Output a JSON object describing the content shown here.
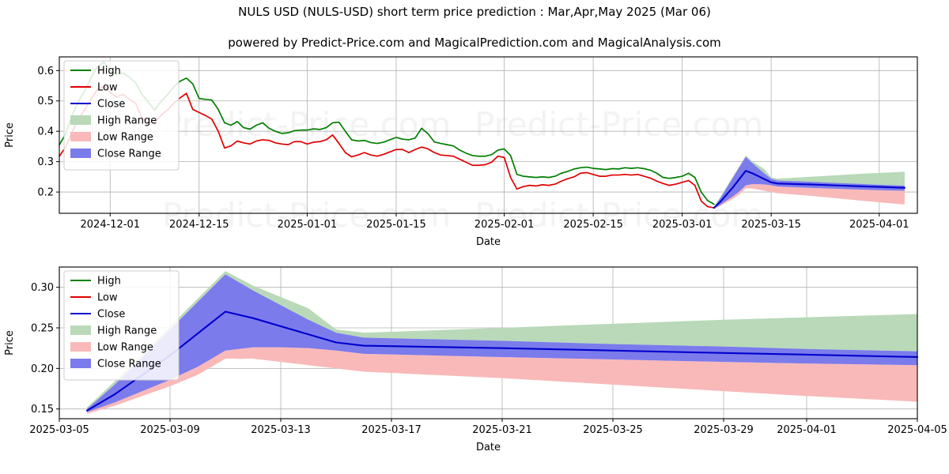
{
  "header": {
    "title": "NULS USD (NULS-USD) short term price prediction : Mar,Apr,May 2025 (Mar 06)",
    "subtitle": "powered by Predict-Price.com and MagicalPrediction.com and MagicalAnalysis.com"
  },
  "watermark": {
    "text": "Predict-Price.com"
  },
  "colors": {
    "high": "#007f00",
    "low": "#e00000",
    "close": "#0000cd",
    "high_range": "#b9d9b9",
    "low_range": "#f9b9b9",
    "close_range": "#7b7bec",
    "grid": "#b0b0b0",
    "frame": "#000000",
    "background": "#ffffff"
  },
  "chart_data": [
    {
      "id": "overview",
      "type": "line",
      "title": "",
      "xlabel": "Date",
      "ylabel": "Price",
      "grid": true,
      "legend_position": "upper left",
      "legend": [
        "High",
        "Low",
        "Close",
        "High Range",
        "Low Range",
        "Close Range"
      ],
      "xlim": [
        "2024-11-23",
        "2025-04-07"
      ],
      "ylim": [
        0.13,
        0.645
      ],
      "yticks": [
        0.2,
        0.3,
        0.4,
        0.5,
        0.6
      ],
      "ytick_labels": [
        "0.2",
        "0.3",
        "0.4",
        "0.5",
        "0.6"
      ],
      "xticks": [
        "2024-12-01",
        "2024-12-15",
        "2025-01-01",
        "2025-01-15",
        "2025-02-01",
        "2025-02-15",
        "2025-03-01",
        "2025-03-15",
        "2025-04-01"
      ],
      "history": {
        "dates": [
          "2024-11-23",
          "2024-11-24",
          "2024-11-25",
          "2024-11-26",
          "2024-11-27",
          "2024-11-28",
          "2024-11-29",
          "2024-11-30",
          "2024-12-01",
          "2024-12-02",
          "2024-12-03",
          "2024-12-04",
          "2024-12-05",
          "2024-12-06",
          "2024-12-07",
          "2024-12-08",
          "2024-12-09",
          "2024-12-10",
          "2024-12-11",
          "2024-12-12",
          "2024-12-13",
          "2024-12-14",
          "2024-12-15",
          "2024-12-16",
          "2024-12-17",
          "2024-12-18",
          "2024-12-19",
          "2024-12-20",
          "2024-12-21",
          "2024-12-22",
          "2024-12-23",
          "2024-12-24",
          "2024-12-25",
          "2024-12-26",
          "2024-12-27",
          "2024-12-28",
          "2024-12-29",
          "2024-12-30",
          "2024-12-31",
          "2025-01-01",
          "2025-01-02",
          "2025-01-03",
          "2025-01-04",
          "2025-01-05",
          "2025-01-06",
          "2025-01-07",
          "2025-01-08",
          "2025-01-09",
          "2025-01-10",
          "2025-01-11",
          "2025-01-12",
          "2025-01-13",
          "2025-01-14",
          "2025-01-15",
          "2025-01-16",
          "2025-01-17",
          "2025-01-18",
          "2025-01-19",
          "2025-01-20",
          "2025-01-21",
          "2025-01-22",
          "2025-01-23",
          "2025-01-24",
          "2025-01-25",
          "2025-01-26",
          "2025-01-27",
          "2025-01-28",
          "2025-01-29",
          "2025-01-30",
          "2025-01-31",
          "2025-02-01",
          "2025-02-02",
          "2025-02-03",
          "2025-02-04",
          "2025-02-05",
          "2025-02-06",
          "2025-02-07",
          "2025-02-08",
          "2025-02-09",
          "2025-02-10",
          "2025-02-11",
          "2025-02-12",
          "2025-02-13",
          "2025-02-14",
          "2025-02-15",
          "2025-02-16",
          "2025-02-17",
          "2025-02-18",
          "2025-02-19",
          "2025-02-20",
          "2025-02-21",
          "2025-02-22",
          "2025-02-23",
          "2025-02-24",
          "2025-02-25",
          "2025-02-26",
          "2025-02-27",
          "2025-02-28",
          "2025-03-01",
          "2025-03-02",
          "2025-03-03",
          "2025-03-04",
          "2025-03-05",
          "2025-03-06"
        ],
        "high": [
          0.355,
          0.392,
          0.452,
          0.497,
          0.534,
          0.577,
          0.612,
          0.628,
          0.6,
          0.588,
          0.592,
          0.578,
          0.56,
          0.522,
          0.496,
          0.47,
          0.498,
          0.52,
          0.546,
          0.565,
          0.575,
          0.556,
          0.508,
          0.505,
          0.503,
          0.472,
          0.428,
          0.42,
          0.432,
          0.412,
          0.407,
          0.42,
          0.428,
          0.41,
          0.4,
          0.393,
          0.395,
          0.402,
          0.404,
          0.404,
          0.408,
          0.406,
          0.412,
          0.428,
          0.43,
          0.4,
          0.372,
          0.368,
          0.37,
          0.363,
          0.36,
          0.364,
          0.372,
          0.38,
          0.374,
          0.372,
          0.378,
          0.41,
          0.392,
          0.365,
          0.36,
          0.356,
          0.352,
          0.338,
          0.328,
          0.32,
          0.318,
          0.318,
          0.323,
          0.338,
          0.342,
          0.32,
          0.258,
          0.252,
          0.25,
          0.248,
          0.25,
          0.248,
          0.252,
          0.262,
          0.268,
          0.276,
          0.28,
          0.282,
          0.278,
          0.276,
          0.274,
          0.277,
          0.276,
          0.28,
          0.278,
          0.28,
          0.277,
          0.272,
          0.262,
          0.248,
          0.245,
          0.248,
          0.252,
          0.262,
          0.248,
          0.2,
          0.172,
          0.16,
          0.158
        ],
        "low": [
          0.318,
          0.348,
          0.398,
          0.44,
          0.472,
          0.506,
          0.538,
          0.548,
          0.528,
          0.512,
          0.522,
          0.506,
          0.492,
          0.445,
          0.428,
          0.43,
          0.452,
          0.47,
          0.492,
          0.51,
          0.525,
          0.472,
          0.462,
          0.452,
          0.44,
          0.4,
          0.345,
          0.352,
          0.368,
          0.362,
          0.358,
          0.368,
          0.372,
          0.37,
          0.362,
          0.358,
          0.356,
          0.366,
          0.366,
          0.358,
          0.364,
          0.366,
          0.372,
          0.388,
          0.36,
          0.33,
          0.316,
          0.322,
          0.33,
          0.322,
          0.318,
          0.324,
          0.332,
          0.34,
          0.34,
          0.33,
          0.34,
          0.348,
          0.342,
          0.33,
          0.322,
          0.32,
          0.318,
          0.308,
          0.298,
          0.288,
          0.288,
          0.29,
          0.298,
          0.318,
          0.314,
          0.248,
          0.21,
          0.218,
          0.222,
          0.22,
          0.224,
          0.222,
          0.226,
          0.236,
          0.244,
          0.25,
          0.262,
          0.264,
          0.258,
          0.252,
          0.252,
          0.256,
          0.256,
          0.258,
          0.256,
          0.258,
          0.252,
          0.246,
          0.236,
          0.228,
          0.222,
          0.226,
          0.232,
          0.238,
          0.222,
          0.17,
          0.152,
          0.148,
          0.15
        ]
      },
      "forecast": {
        "dates": [
          "2025-03-06",
          "2025-03-07",
          "2025-03-08",
          "2025-03-09",
          "2025-03-10",
          "2025-03-11",
          "2025-03-12",
          "2025-03-13",
          "2025-03-14",
          "2025-03-15",
          "2025-03-16",
          "2025-03-21",
          "2025-03-25",
          "2025-03-29",
          "2025-04-01",
          "2025-04-05"
        ],
        "close": [
          0.148,
          0.168,
          0.192,
          0.216,
          0.243,
          0.27,
          0.262,
          0.252,
          0.242,
          0.232,
          0.228,
          0.225,
          0.222,
          0.219,
          0.217,
          0.214
        ],
        "close_upper": [
          0.15,
          0.18,
          0.214,
          0.248,
          0.282,
          0.316,
          0.296,
          0.278,
          0.26,
          0.244,
          0.238,
          0.234,
          0.23,
          0.227,
          0.224,
          0.221
        ],
        "close_lower": [
          0.146,
          0.158,
          0.172,
          0.186,
          0.202,
          0.222,
          0.226,
          0.226,
          0.225,
          0.222,
          0.218,
          0.214,
          0.211,
          0.208,
          0.206,
          0.204
        ],
        "high_upper": [
          0.152,
          0.184,
          0.218,
          0.252,
          0.286,
          0.32,
          0.302,
          0.288,
          0.274,
          0.248,
          0.244,
          0.25,
          0.255,
          0.26,
          0.263,
          0.267
        ],
        "low_lower": [
          0.144,
          0.154,
          0.166,
          0.178,
          0.192,
          0.212,
          0.212,
          0.208,
          0.204,
          0.2,
          0.196,
          0.188,
          0.18,
          0.172,
          0.166,
          0.159
        ]
      }
    },
    {
      "id": "forecast-detail",
      "type": "line",
      "title": "",
      "xlabel": "Date",
      "ylabel": "Price",
      "grid": true,
      "legend_position": "upper left",
      "legend": [
        "High",
        "Low",
        "Close",
        "High Range",
        "Low Range",
        "Close Range"
      ],
      "xlim": [
        "2025-03-05",
        "2025-04-05"
      ],
      "ylim": [
        0.138,
        0.325
      ],
      "yticks": [
        0.15,
        0.2,
        0.25,
        0.3
      ],
      "ytick_labels": [
        "0.15",
        "0.20",
        "0.25",
        "0.30"
      ],
      "xticks": [
        "2025-03-05",
        "2025-03-09",
        "2025-03-13",
        "2025-03-17",
        "2025-03-21",
        "2025-03-25",
        "2025-03-29",
        "2025-04-01",
        "2025-04-05"
      ],
      "forecast": {
        "dates": [
          "2025-03-06",
          "2025-03-07",
          "2025-03-08",
          "2025-03-09",
          "2025-03-10",
          "2025-03-11",
          "2025-03-12",
          "2025-03-13",
          "2025-03-14",
          "2025-03-15",
          "2025-03-16",
          "2025-03-21",
          "2025-03-25",
          "2025-03-29",
          "2025-04-01",
          "2025-04-05"
        ],
        "close": [
          0.148,
          0.168,
          0.192,
          0.216,
          0.243,
          0.27,
          0.262,
          0.252,
          0.242,
          0.232,
          0.228,
          0.225,
          0.222,
          0.219,
          0.217,
          0.214
        ],
        "close_upper": [
          0.15,
          0.18,
          0.214,
          0.248,
          0.282,
          0.316,
          0.296,
          0.278,
          0.26,
          0.244,
          0.238,
          0.234,
          0.23,
          0.227,
          0.224,
          0.221
        ],
        "close_lower": [
          0.146,
          0.158,
          0.172,
          0.186,
          0.202,
          0.222,
          0.226,
          0.226,
          0.225,
          0.222,
          0.218,
          0.214,
          0.211,
          0.208,
          0.206,
          0.204
        ],
        "high_upper": [
          0.152,
          0.184,
          0.218,
          0.252,
          0.286,
          0.32,
          0.302,
          0.288,
          0.274,
          0.248,
          0.244,
          0.25,
          0.255,
          0.26,
          0.263,
          0.267
        ],
        "low_lower": [
          0.144,
          0.154,
          0.166,
          0.178,
          0.192,
          0.212,
          0.212,
          0.208,
          0.204,
          0.2,
          0.196,
          0.188,
          0.18,
          0.172,
          0.166,
          0.159
        ]
      }
    }
  ]
}
